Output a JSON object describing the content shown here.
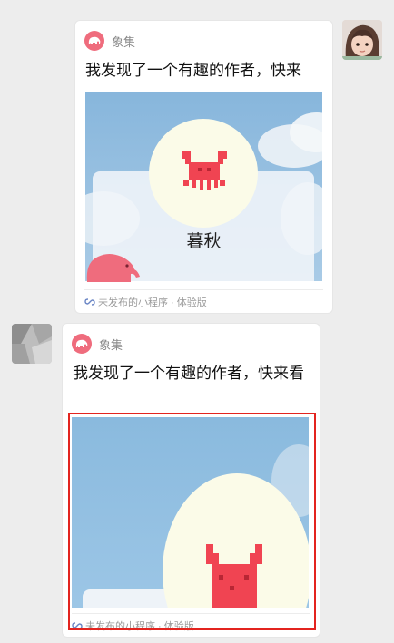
{
  "messages": [
    {
      "app_name": "象集",
      "title": "我发现了一个有趣的作者，快来",
      "card_name": "暮秋",
      "footer": "未发布的小程序 · 体验版"
    },
    {
      "app_name": "象集",
      "title": "我发现了一个有趣的作者，快来看",
      "footer": "未发布的小程序 · 体验版"
    }
  ],
  "colors": {
    "background": "#ededed",
    "sky": "#8fbde0",
    "brand_pink": "#ef6c7d",
    "crab": "#f04452",
    "highlight": "#e3241f"
  },
  "icons": [
    "elephant-logo-icon",
    "link-icon",
    "crab-icon"
  ]
}
